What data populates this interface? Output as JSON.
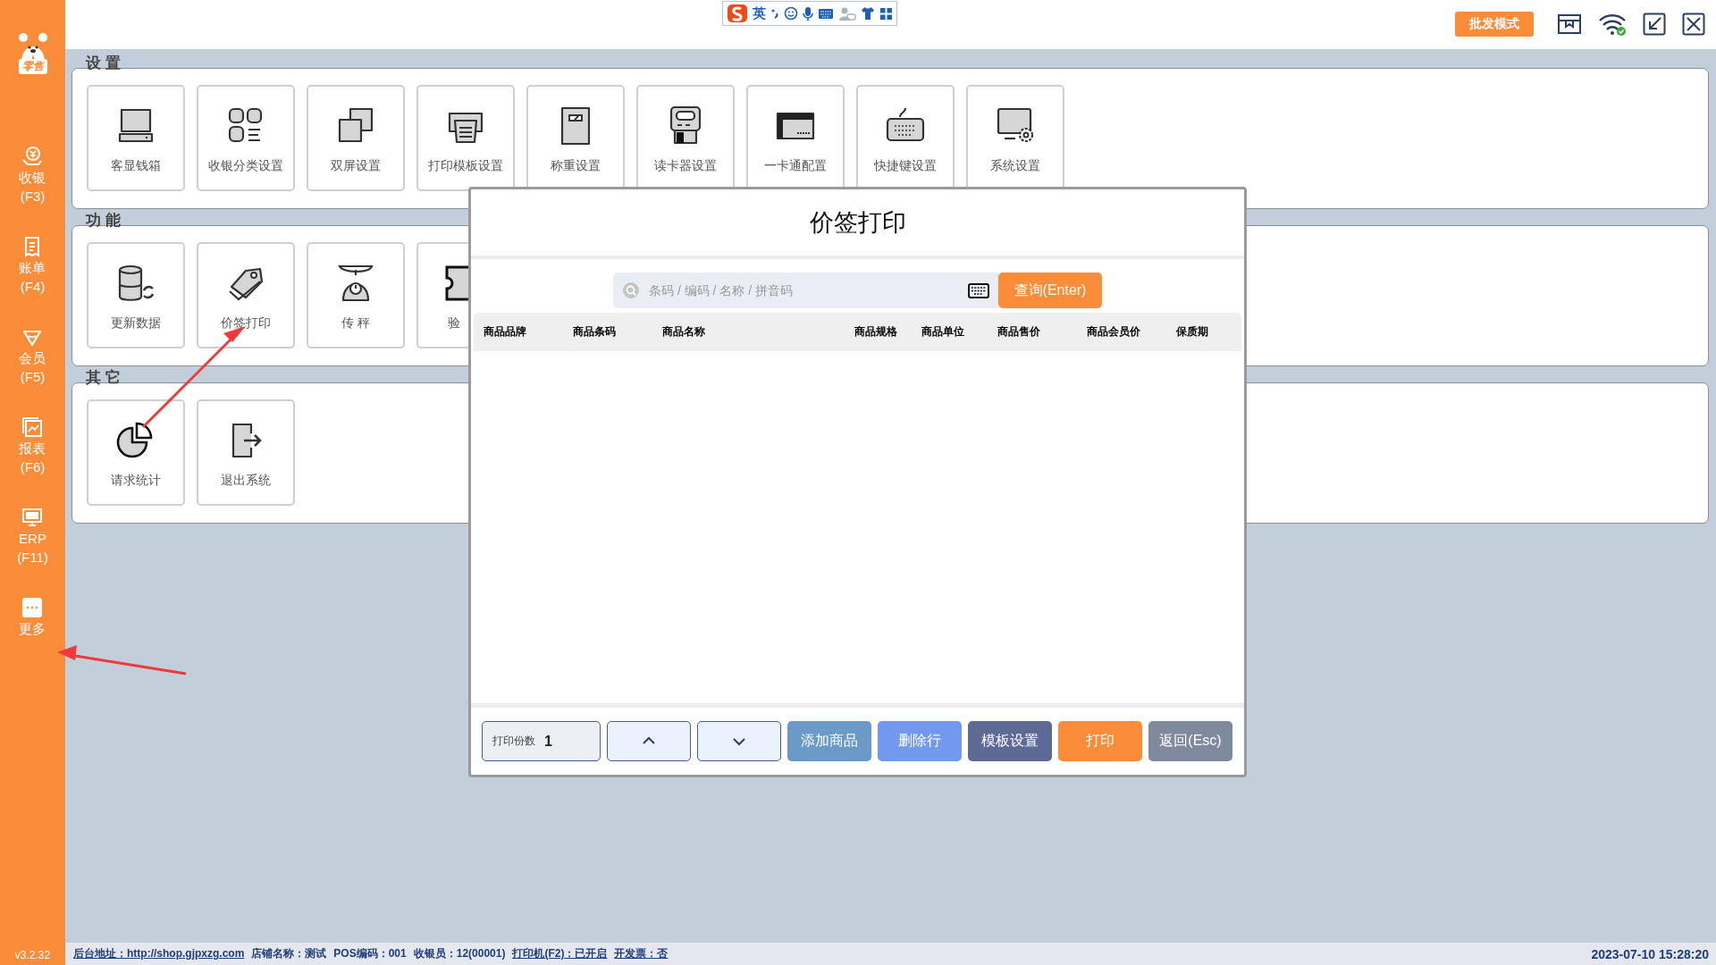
{
  "sidebar": {
    "logo_label": "零售",
    "items": [
      {
        "label": "收银",
        "shortcut": "(F3)"
      },
      {
        "label": "账单",
        "shortcut": "(F4)"
      },
      {
        "label": "会员",
        "shortcut": "(F5)"
      },
      {
        "label": "报表",
        "shortcut": "(F6)"
      },
      {
        "label": "ERP",
        "shortcut": "(F11)"
      },
      {
        "label": "更多"
      }
    ],
    "version": "v3.2.32"
  },
  "ime_toolbar": {
    "language": "英"
  },
  "top_bar": {
    "mode_button": "批发模式",
    "wifi_connected": true
  },
  "sections": [
    {
      "title": "设 置",
      "tiles": [
        {
          "label": "客显钱箱"
        },
        {
          "label": "收银分类设置"
        },
        {
          "label": "双屏设置"
        },
        {
          "label": "打印模板设置"
        },
        {
          "label": "称重设置"
        },
        {
          "label": "读卡器设置"
        },
        {
          "label": "一卡通配置"
        },
        {
          "label": "快捷键设置"
        },
        {
          "label": "系统设置"
        }
      ]
    },
    {
      "title": "功 能",
      "tiles": [
        {
          "label": "更新数据"
        },
        {
          "label": "价签打印"
        },
        {
          "label": "传 秤"
        },
        {
          "label": "验",
          "partial": true
        }
      ]
    },
    {
      "title": "其 它",
      "tiles": [
        {
          "label": "请求统计"
        },
        {
          "label": "退出系统"
        }
      ]
    }
  ],
  "dialog": {
    "title": "价签打印",
    "search": {
      "placeholder": "条码 / 编码 / 名称 / 拼音码"
    },
    "search_button": "查询(Enter)",
    "columns": [
      "商品品牌",
      "商品条码",
      "商品名称",
      "商品规格",
      "商品单位",
      "商品售价",
      "商品会员价",
      "保质期"
    ],
    "copies": {
      "label": "打印份数",
      "value": "1"
    },
    "buttons": [
      {
        "kind": "up"
      },
      {
        "kind": "down"
      },
      {
        "kind": "add",
        "label": "添加商品"
      },
      {
        "kind": "delete",
        "label": "删除行"
      },
      {
        "kind": "template",
        "label": "模板设置"
      },
      {
        "kind": "print",
        "label": "打印"
      },
      {
        "kind": "back",
        "label": "返回(Esc)"
      }
    ]
  },
  "annotations": [
    {
      "kind": "arrow"
    },
    {
      "kind": "arrow"
    }
  ],
  "status_bar": {
    "items": [
      {
        "text": "后台地址：http://shop.gjpxzg.com",
        "link": true
      },
      {
        "text": "店铺名称：测试",
        "link": false
      },
      {
        "text": "POS编码：001",
        "link": false
      },
      {
        "text": "收银员：12(00001)",
        "link": false
      },
      {
        "text": "打印机(F2)：已开启",
        "link": true
      },
      {
        "text": "开发票：否",
        "link": true
      }
    ],
    "datetime": "2023-07-10 15:28:20"
  }
}
